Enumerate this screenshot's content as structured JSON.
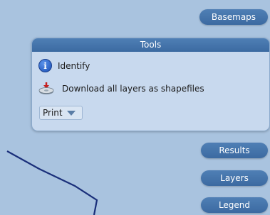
{
  "colors": {
    "map_background": "#a9c3df",
    "button_blue": "#3c6aa1",
    "panel_background": "#c8d9ee",
    "boundary_line": "#1a2f7a"
  },
  "nav": {
    "basemaps": "Basemaps",
    "results": "Results",
    "layers": "Layers",
    "legend": "Legend"
  },
  "tools": {
    "title": "Tools",
    "identify": {
      "label": "Identify",
      "icon": "info-icon"
    },
    "download": {
      "label": "Download all layers as shapefiles",
      "icon": "download-disk-icon"
    },
    "print": {
      "label": "Print",
      "icon": "chevron-down-icon"
    }
  }
}
